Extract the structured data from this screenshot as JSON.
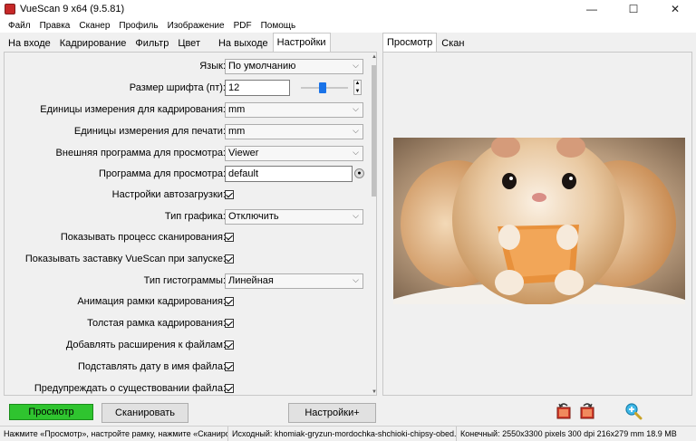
{
  "window": {
    "title": "VueScan 9 x64 (9.5.81)",
    "controls": {
      "minimize": "—",
      "maximize": "☐",
      "close": "✕"
    }
  },
  "menu": [
    "Файл",
    "Правка",
    "Сканер",
    "Профиль",
    "Изображение",
    "PDF",
    "Помощь"
  ],
  "left_tabs": [
    {
      "label": "На входе",
      "active": false
    },
    {
      "label": "Кадрирование",
      "active": false
    },
    {
      "label": "Фильтр",
      "active": false
    },
    {
      "label": "Цвет",
      "active": false
    },
    {
      "label": "На выходе",
      "active": false
    },
    {
      "label": "Настройки",
      "active": true
    }
  ],
  "settings": {
    "language": {
      "label": "Язык:",
      "value": "По умолчанию"
    },
    "font_size": {
      "label": "Размер шрифта (пт):",
      "value": "12",
      "slider_level": 0.45
    },
    "crop_units": {
      "label": "Единицы измерения для кадрирования:",
      "value": "mm"
    },
    "print_units": {
      "label": "Единицы измерения для печати:",
      "value": "mm"
    },
    "external_viewer": {
      "label": "Внешняя программа для просмотра:",
      "value": "Viewer"
    },
    "viewer_program": {
      "label": "Программа для просмотра:",
      "value": "default"
    },
    "autoload": {
      "label": "Настройки автозагрузки:",
      "checked": true
    },
    "graph_type": {
      "label": "Тип графика:",
      "value": "Отключить"
    },
    "show_progress": {
      "label": "Показывать процесс сканирования:",
      "checked": true
    },
    "show_splash": {
      "label": "Показывать заставку VueScan при запуске:",
      "checked": true
    },
    "histogram_type": {
      "label": "Тип гистограммы:",
      "value": "Линейная"
    },
    "animate_crop": {
      "label": "Анимация рамки кадрирования:",
      "checked": true
    },
    "thick_crop": {
      "label": "Толстая рамка кадрирования:",
      "checked": true
    },
    "add_extensions": {
      "label": "Добавлять расширения к файлам:",
      "checked": true
    },
    "date_in_name": {
      "label": "Подставлять дату в имя файла:",
      "checked": true
    },
    "warn_exists": {
      "label": "Предупреждать о существовании файла:",
      "checked": true
    }
  },
  "right_tabs": [
    {
      "label": "Просмотр",
      "active": true
    },
    {
      "label": "Скан",
      "active": false
    }
  ],
  "buttons": {
    "preview": "Просмотр",
    "scan": "Сканировать",
    "more": "Настройки+"
  },
  "status": {
    "hint": "Нажмите «Просмотр», настройте рамку, нажмите «Сканировать»",
    "source": "Исходный: khomiak-gryzun-mordochka-shchioki-chipsy-obed.jpg",
    "output": "Конечный: 2550x3300 pixels 300 dpi 216x279 mm 18.9 MB"
  },
  "colors": {
    "accent_blue": "#1a73e8",
    "preview_button": "#2fc42f"
  }
}
